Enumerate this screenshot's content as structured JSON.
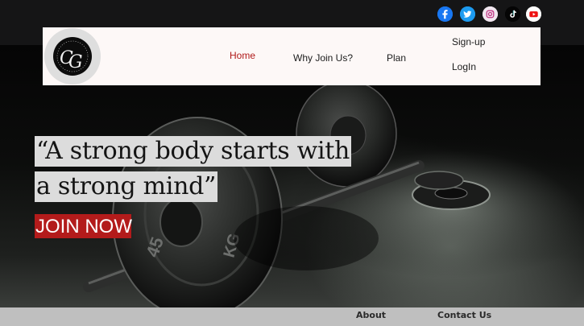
{
  "social": {
    "facebook": "facebook-icon",
    "twitter": "twitter-icon",
    "instagram": "instagram-icon",
    "tiktok": "tiktok-icon",
    "youtube": "youtube-icon"
  },
  "logo": {
    "monogram": "CG"
  },
  "nav": {
    "home": "Home",
    "why_join": "Why Join Us?",
    "plan": "Plan",
    "signup": "Sign-up",
    "login": "LogIn"
  },
  "hero": {
    "quote_line1": "“A strong body starts with",
    "quote_line2": "a strong mind”",
    "cta": "JOIN NOW"
  },
  "footer": {
    "about": "About",
    "contact": "Contact Us"
  },
  "colors": {
    "accent": "#b31b1b",
    "topbar": "#151516",
    "nav_bg": "#fdf8f7"
  }
}
